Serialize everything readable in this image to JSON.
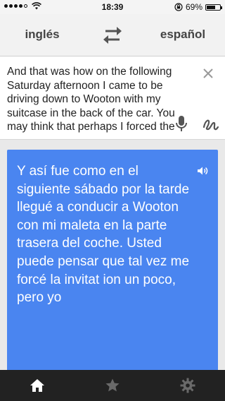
{
  "status_bar": {
    "time": "18:39",
    "battery_percent_label": "69%",
    "battery_level": 0.69,
    "signal_icon": "signal-dots-icon",
    "wifi_icon": "wifi-icon",
    "rotation_lock_icon": "rotation-lock-icon"
  },
  "language_bar": {
    "source_language": "inglés",
    "target_language": "español",
    "swap_icon": "swap-arrows-icon"
  },
  "input": {
    "text": "And that was how on the following Saturday afternoon I came to be driving down to Wooton with my suitcase in the back of the car. You may think that perhaps I forced the",
    "close_icon": "close-icon",
    "mic_icon": "microphone-icon",
    "handwriting_icon": "handwriting-icon"
  },
  "result": {
    "text": "Y así fue como en el siguiente sábado por la tarde llegué a conducir a Wooton con mi maleta en la parte trasera del coche. Usted puede pensar que tal vez me forcé la invitat ion un poco, pero yo",
    "speaker_icon": "speaker-icon",
    "background_color": "#4a85f0"
  },
  "tab_bar": {
    "tabs": [
      {
        "name": "home",
        "icon": "home-icon",
        "active": true
      },
      {
        "name": "favorites",
        "icon": "star-icon",
        "active": false
      },
      {
        "name": "settings",
        "icon": "gear-icon",
        "active": false
      }
    ]
  }
}
